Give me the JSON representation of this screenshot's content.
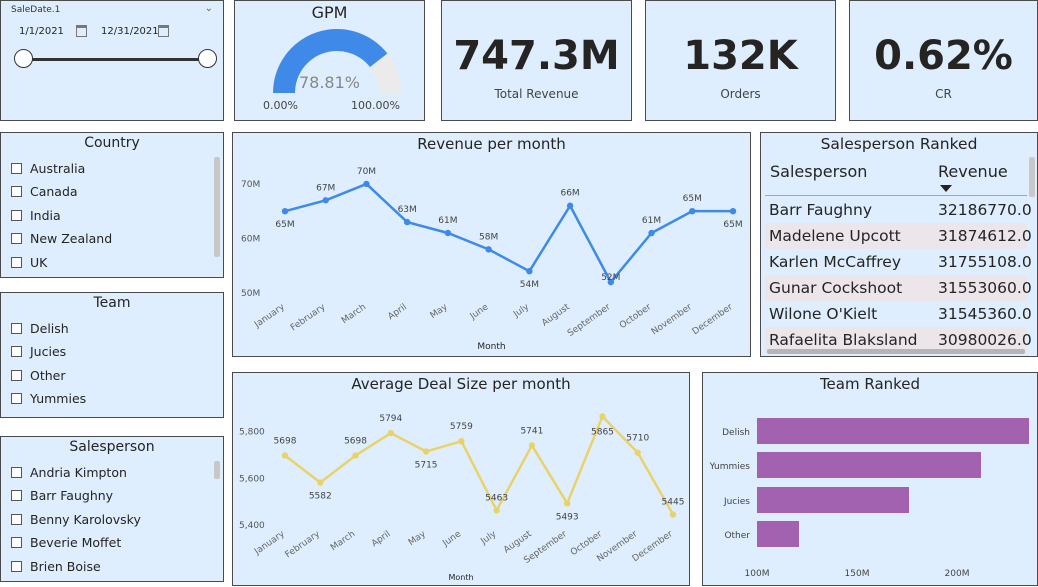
{
  "date_slicer": {
    "title": "SaleDate.1",
    "start": "1/1/2021",
    "end": "12/31/2021"
  },
  "gpm": {
    "title": "GPM",
    "value": "78.81%",
    "min": "0.00%",
    "max": "100.00%",
    "fraction": 0.7881
  },
  "kpis": [
    {
      "value": "747.3M",
      "label": "Total Revenue"
    },
    {
      "value": "132K",
      "label": "Orders"
    },
    {
      "value": "0.62%",
      "label": "CR"
    }
  ],
  "country_slicer": {
    "title": "Country",
    "items": [
      "Australia",
      "Canada",
      "India",
      "New Zealand",
      "UK"
    ]
  },
  "team_slicer": {
    "title": "Team",
    "items": [
      "Delish",
      "Jucies",
      "Other",
      "Yummies"
    ]
  },
  "salesperson_slicer": {
    "title": "Salesperson",
    "items": [
      "Andria Kimpton",
      "Barr Faughny",
      "Benny Karolovsky",
      "Beverie Moffet",
      "Brien Boise"
    ]
  },
  "salesperson_ranked": {
    "title": "Salesperson Ranked",
    "headers": [
      "Salesperson",
      "Revenue"
    ],
    "rows": [
      [
        "Barr Faughny",
        "32186770.0"
      ],
      [
        "Madelene Upcott",
        "31874612.0"
      ],
      [
        "Karlen McCaffrey",
        "31755108.0"
      ],
      [
        "Gunar Cockshoot",
        "31553060.0"
      ],
      [
        "Wilone O'Kielt",
        "31545360.0"
      ],
      [
        "Rafaelita Blaksland",
        "30980026.0"
      ]
    ]
  },
  "chart_data": [
    {
      "type": "line",
      "title": "Revenue per month",
      "xlabel": "Month",
      "ylabel": "",
      "categories": [
        "January",
        "February",
        "March",
        "April",
        "May",
        "June",
        "July",
        "August",
        "September",
        "October",
        "November",
        "December"
      ],
      "values": [
        65,
        67,
        70,
        63,
        61,
        58,
        54,
        66,
        52,
        61,
        65,
        65
      ],
      "data_labels": [
        "65M",
        "67M",
        "70M",
        "63M",
        "61M",
        "58M",
        "54M",
        "66M",
        "52M",
        "61M",
        "65M",
        "65M"
      ],
      "yticks": [
        "50M",
        "60M",
        "70M"
      ],
      "ylim": [
        50,
        72
      ],
      "color": "#3f8ae8"
    },
    {
      "type": "line",
      "title": "Average Deal Size per month",
      "xlabel": "Month",
      "ylabel": "",
      "categories": [
        "January",
        "February",
        "March",
        "April",
        "May",
        "June",
        "July",
        "August",
        "September",
        "October",
        "November",
        "December"
      ],
      "values": [
        5698,
        5582,
        5698,
        5794,
        5715,
        5759,
        5463,
        5741,
        5493,
        5865,
        5710,
        5445
      ],
      "data_labels": [
        "5698",
        "5582",
        "5698",
        "5794",
        "5715",
        "5759",
        "5463",
        "5741",
        "5493",
        "5865",
        "5710",
        "5445"
      ],
      "yticks": [
        "5,400",
        "5,600",
        "5,800"
      ],
      "ylim": [
        5400,
        5880
      ],
      "color": "#e8d36a"
    },
    {
      "type": "bar",
      "title": "Team Ranked",
      "categories": [
        "Delish",
        "Yummies",
        "Jucies",
        "Other"
      ],
      "values": [
        236,
        212,
        176,
        121
      ],
      "xticks": [
        "100M",
        "150M",
        "200M"
      ],
      "xlim": [
        100,
        240
      ],
      "color": "#a362b0"
    }
  ]
}
